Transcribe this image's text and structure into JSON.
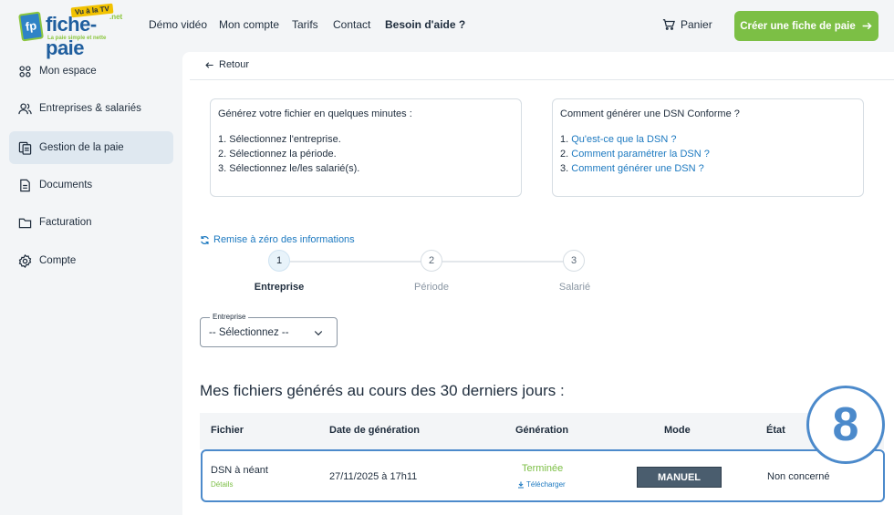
{
  "brand": {
    "name": "fiche-paie",
    "tv_banner": "Vu à la TV",
    "tld": ".net",
    "tagline": "La paie simple et nette",
    "logo_letters": "fp"
  },
  "nav": {
    "demo": "Démo vidéo",
    "account": "Mon compte",
    "pricing": "Tarifs",
    "contact": "Contact",
    "help": "Besoin d'aide ?",
    "cart": "Panier",
    "cta": "Créer une fiche de paie"
  },
  "sidebar": {
    "items": [
      {
        "label": "Mon espace",
        "icon": "grid-icon"
      },
      {
        "label": "Entreprises & salariés",
        "icon": "users-icon"
      },
      {
        "label": "Gestion de la paie",
        "icon": "payroll-icon"
      },
      {
        "label": "Documents",
        "icon": "document-icon"
      },
      {
        "label": "Facturation",
        "icon": "folder-icon"
      },
      {
        "label": "Compte",
        "icon": "settings-icon"
      }
    ],
    "active_index": 2
  },
  "main": {
    "back": "Retour",
    "info_left": {
      "title": "Générez votre fichier en quelques minutes :",
      "items": [
        "1. Sélectionnez l'entreprise.",
        "2. Sélectionnez la période.",
        "3. Sélectionnez le/les salarié(s)."
      ]
    },
    "info_right": {
      "title": "Comment générer une DSN Conforme ?",
      "numbers": [
        "1.",
        "2.",
        "3."
      ],
      "links": [
        "Qu'est-ce que la DSN ?",
        "Comment paramétrer la DSN ?",
        "Comment générer une DSN ?"
      ]
    },
    "reset": "Remise à zéro des informations",
    "steps": [
      {
        "num": "1",
        "label": "Entreprise"
      },
      {
        "num": "2",
        "label": "Période"
      },
      {
        "num": "3",
        "label": "Salarié"
      }
    ],
    "active_step": 1,
    "company_select": {
      "legend": "Entreprise",
      "value": "-- Sélectionnez --"
    },
    "files_title": "Mes fichiers générés au cours des 30 derniers jours :",
    "table": {
      "headers": [
        "Fichier",
        "Date de génération",
        "Génération",
        "Mode",
        "État"
      ],
      "rows": [
        {
          "file": "DSN à néant",
          "details": "Détails",
          "date": "27/11/2025 à 17h11",
          "status": "Terminée",
          "download": "Télécharger",
          "mode": "MANUEL",
          "state": "Non concerné"
        }
      ]
    },
    "badge": "8"
  }
}
